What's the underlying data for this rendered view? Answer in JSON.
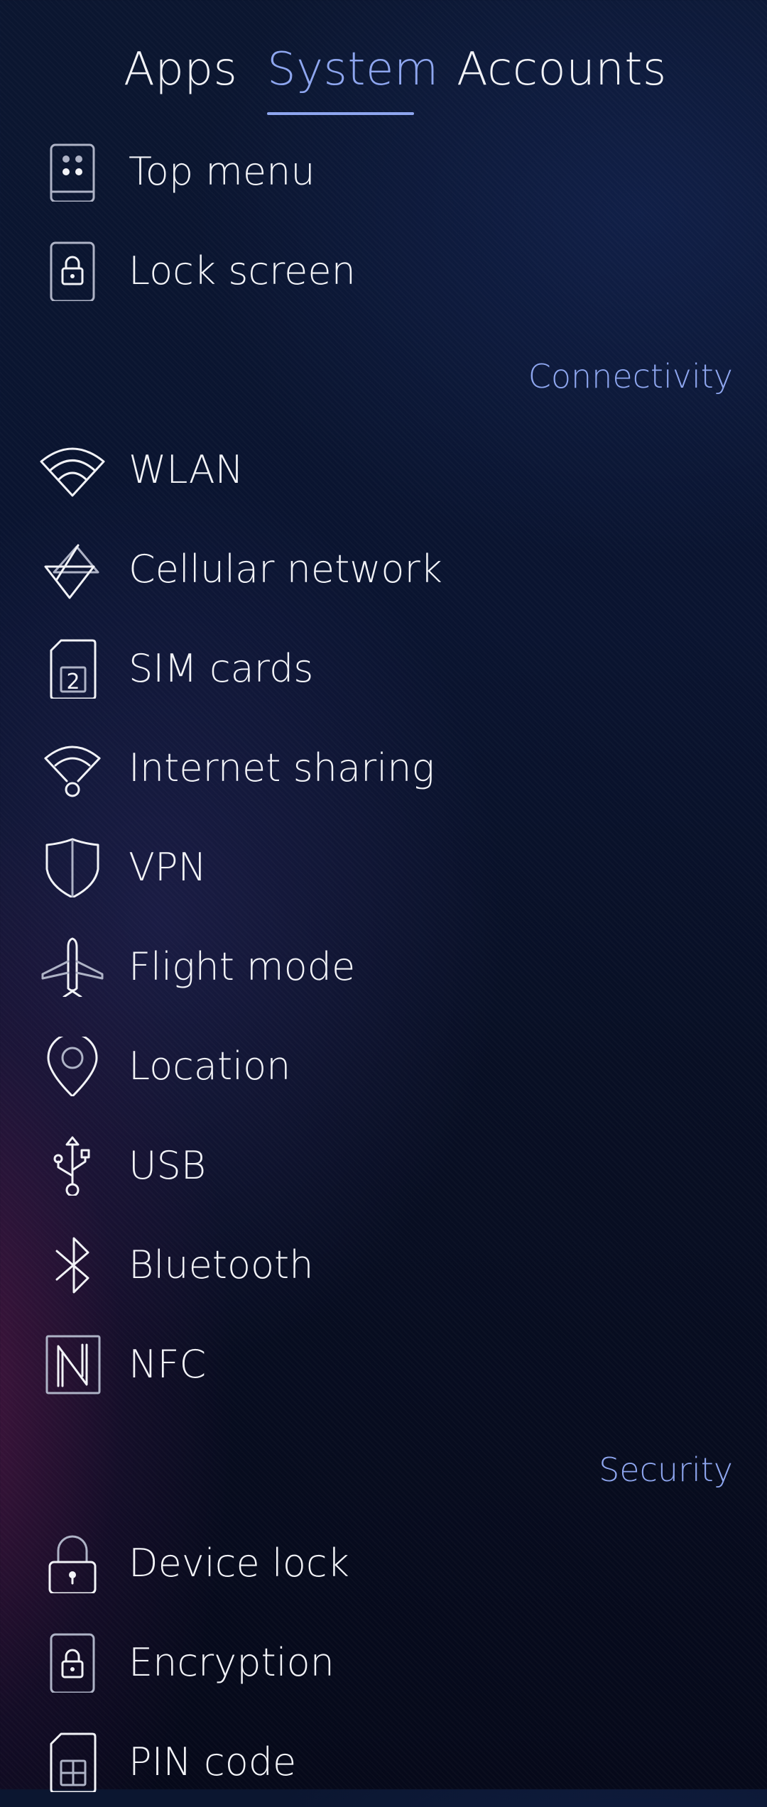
{
  "tabs": [
    {
      "label": "Apps",
      "active": false
    },
    {
      "label": "System",
      "active": true
    },
    {
      "label": "Accounts",
      "active": false
    }
  ],
  "accent_color": "#8ea6ef",
  "items": {
    "top_menu": {
      "label": "Top menu",
      "icon": "top-menu-icon"
    },
    "lock_screen": {
      "label": "Lock screen",
      "icon": "lock-screen-icon"
    },
    "wlan": {
      "label": "WLAN",
      "icon": "wifi-icon"
    },
    "cellular": {
      "label": "Cellular network",
      "icon": "cellular-network-icon"
    },
    "sim": {
      "label": "SIM cards",
      "icon": "sim-card-icon"
    },
    "sharing": {
      "label": "Internet sharing",
      "icon": "hotspot-icon"
    },
    "vpn": {
      "label": "VPN",
      "icon": "shield-icon"
    },
    "flight": {
      "label": "Flight mode",
      "icon": "airplane-icon"
    },
    "location": {
      "label": "Location",
      "icon": "location-pin-icon"
    },
    "usb": {
      "label": "USB",
      "icon": "usb-icon"
    },
    "bluetooth": {
      "label": "Bluetooth",
      "icon": "bluetooth-icon"
    },
    "nfc": {
      "label": "NFC",
      "icon": "nfc-icon"
    },
    "device_lock": {
      "label": "Device lock",
      "icon": "padlock-icon"
    },
    "encryption": {
      "label": "Encryption",
      "icon": "encryption-icon"
    },
    "pin": {
      "label": "PIN code",
      "icon": "pin-code-icon"
    }
  },
  "sections": {
    "connectivity": "Connectivity",
    "security": "Security"
  }
}
